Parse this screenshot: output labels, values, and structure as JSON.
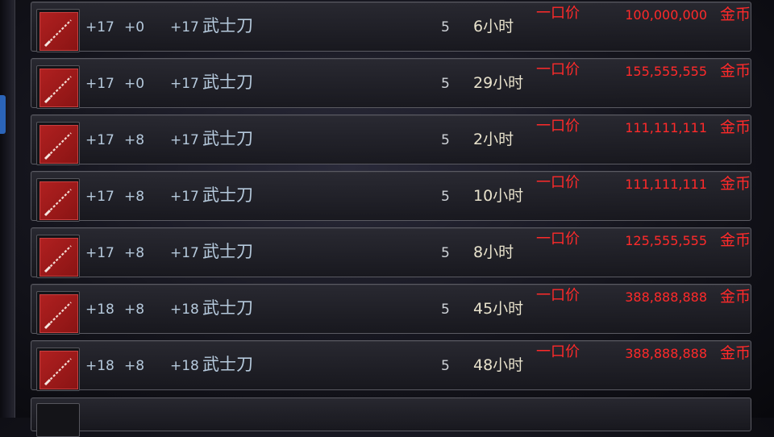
{
  "auction_list": {
    "rows": [
      {
        "enh_a": "+17",
        "enh_b": "+0",
        "enh_c": "+17",
        "name": "武士刀",
        "qty": "5",
        "time": "6小时",
        "buyout_label": "一口价",
        "price": "100,000,000",
        "currency": "金币",
        "icon": "sword-icon"
      },
      {
        "enh_a": "+17",
        "enh_b": "+0",
        "enh_c": "+17",
        "name": "武士刀",
        "qty": "5",
        "time": "29小时",
        "buyout_label": "一口价",
        "price": "155,555,555",
        "currency": "金币",
        "icon": "sword-icon"
      },
      {
        "enh_a": "+17",
        "enh_b": "+8",
        "enh_c": "+17",
        "name": "武士刀",
        "qty": "5",
        "time": "2小时",
        "buyout_label": "一口价",
        "price": "111,111,111",
        "currency": "金币",
        "icon": "sword-icon"
      },
      {
        "enh_a": "+17",
        "enh_b": "+8",
        "enh_c": "+17",
        "name": "武士刀",
        "qty": "5",
        "time": "10小时",
        "buyout_label": "一口价",
        "price": "111,111,111",
        "currency": "金币",
        "icon": "sword-icon"
      },
      {
        "enh_a": "+17",
        "enh_b": "+8",
        "enh_c": "+17",
        "name": "武士刀",
        "qty": "5",
        "time": "8小时",
        "buyout_label": "一口价",
        "price": "125,555,555",
        "currency": "金币",
        "icon": "sword-icon"
      },
      {
        "enh_a": "+18",
        "enh_b": "+8",
        "enh_c": "+18",
        "name": "武士刀",
        "qty": "5",
        "time": "45小时",
        "buyout_label": "一口价",
        "price": "388,888,888",
        "currency": "金币",
        "icon": "sword-icon"
      },
      {
        "enh_a": "+18",
        "enh_b": "+8",
        "enh_c": "+18",
        "name": "武士刀",
        "qty": "5",
        "time": "48小时",
        "buyout_label": "一口价",
        "price": "388,888,888",
        "currency": "金币",
        "icon": "sword-icon"
      }
    ]
  },
  "colors": {
    "price_red": "#ff2a2a",
    "stat_blue": "#b5c9dc",
    "icon_bg": "#b02020",
    "left_tab_blue": "#2b64b8"
  }
}
